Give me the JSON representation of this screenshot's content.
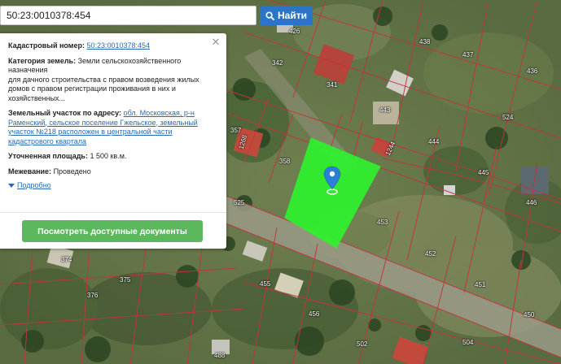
{
  "search": {
    "query": "50:23:0010378:454",
    "button_label": "Найти"
  },
  "info": {
    "cadastral_label": "Кадастровый номер:",
    "cadastral_value": "50:23:0010378:454",
    "category_label": "Категория земель:",
    "category_line1": "Земли сельскохозяйственного",
    "category_line2": "назначения",
    "category_line3": "для дачного строительства с правом возведения жилых",
    "category_line4": "домов с правом регистрации проживания в них и",
    "category_line5": "хозяйственных...",
    "address_label": "Земельный участок по адресу:",
    "address_line1": "обл. Московская, р-н",
    "address_line2": "Раменский, сельское поселение Гжельское, земельный",
    "address_line3": "участок №218 расположен в центральной части",
    "address_line4": "кадастрового квартала",
    "area_label": "Уточненная площадь:",
    "area_value": "1 500 кв.м.",
    "survey_label": "Межевание:",
    "survey_value": "Проведено",
    "more_label": "Подробно",
    "docs_button": "Посмотреть доступные документы"
  },
  "plot_numbers": [
    "426",
    "438",
    "437",
    "436",
    "524",
    "342",
    "341",
    "443",
    "357",
    "1268",
    "1244",
    "444",
    "445",
    "446",
    "358",
    "525",
    "453",
    "452",
    "451",
    "374",
    "375",
    "455",
    "376",
    "456",
    "450",
    "488",
    "502",
    "504"
  ],
  "colors": {
    "selected_plot": "#2ef32e",
    "boundary_lines": "#c4343c",
    "search_button": "#2a75c7",
    "docs_button": "#5cb85c",
    "marker": "#2a7fd4"
  },
  "icons": {
    "search": "magnifier-icon",
    "close": "close-icon",
    "expand": "triangle-down-icon",
    "marker": "map-pin-icon"
  }
}
